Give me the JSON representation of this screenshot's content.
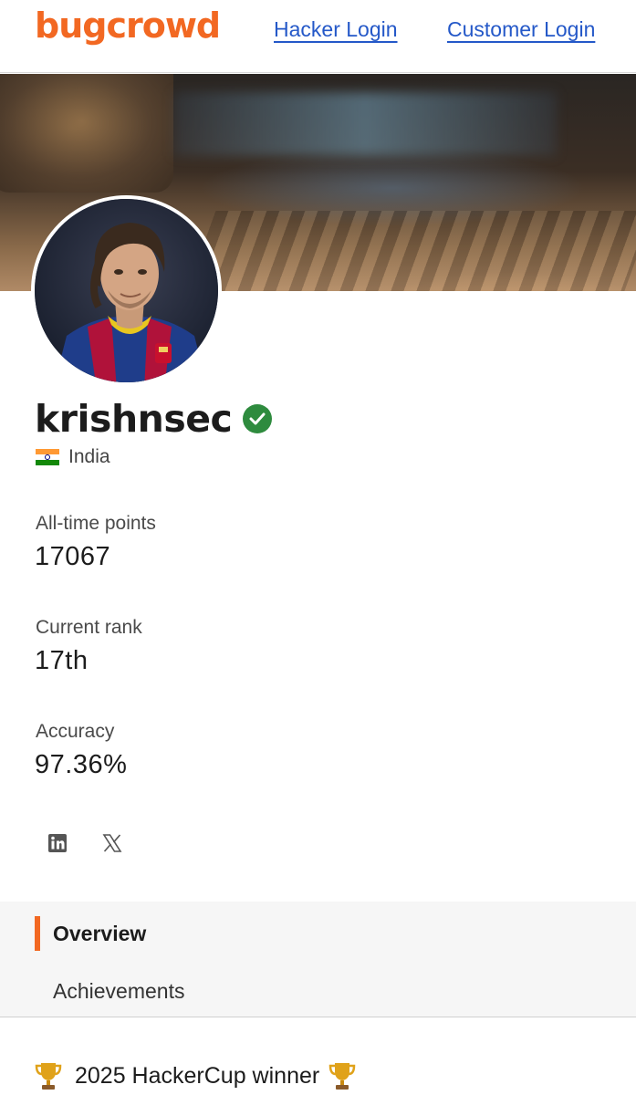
{
  "colors": {
    "brand": "#f26822",
    "link": "#2458c8",
    "verified": "#2e8b3e",
    "tab_indicator": "#f26822"
  },
  "header": {
    "logo_text": "bugcrowd",
    "hacker_login": "Hacker Login",
    "customer_login": "Customer Login"
  },
  "profile": {
    "username": "krishnsec",
    "verified_icon": "verified-check-icon",
    "country": "India",
    "flag_icon": "india-flag-icon"
  },
  "stats": [
    {
      "label": "All-time points",
      "value": "17067"
    },
    {
      "label": "Current rank",
      "value": "17th"
    },
    {
      "label": "Accuracy",
      "value": "97.36%"
    }
  ],
  "social": [
    {
      "icon": "linkedin-icon"
    },
    {
      "icon": "x-twitter-icon"
    }
  ],
  "tabs": [
    {
      "label": "Overview",
      "active": true
    },
    {
      "label": "Achievements",
      "active": false
    }
  ],
  "overview": {
    "highlight": "2025 HackerCup winner",
    "highlight_icon": "trophy-icon"
  }
}
